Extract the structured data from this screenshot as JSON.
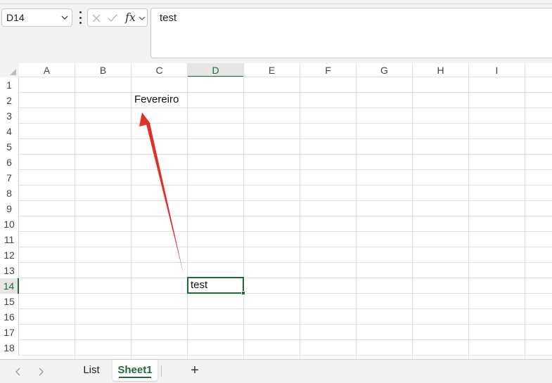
{
  "formula_bar": {
    "name_box": "D14",
    "formula": "test",
    "fx_label": "fx"
  },
  "columns": [
    "A",
    "B",
    "C",
    "D",
    "E",
    "F",
    "G",
    "H",
    "I"
  ],
  "rows": [
    "1",
    "2",
    "3",
    "4",
    "5",
    "6",
    "7",
    "8",
    "9",
    "10",
    "11",
    "12",
    "13",
    "14",
    "15",
    "16",
    "17",
    "18"
  ],
  "active_column": "D",
  "active_row": "14",
  "cells": {
    "C2": "Fevereiro",
    "D14": "test"
  },
  "sheet_tabs": [
    {
      "label": "List",
      "active": false
    },
    {
      "label": "Sheet1",
      "active": true
    }
  ],
  "colors": {
    "accent": "#1e6b3c",
    "annotation_arrow": "#e0302a"
  }
}
